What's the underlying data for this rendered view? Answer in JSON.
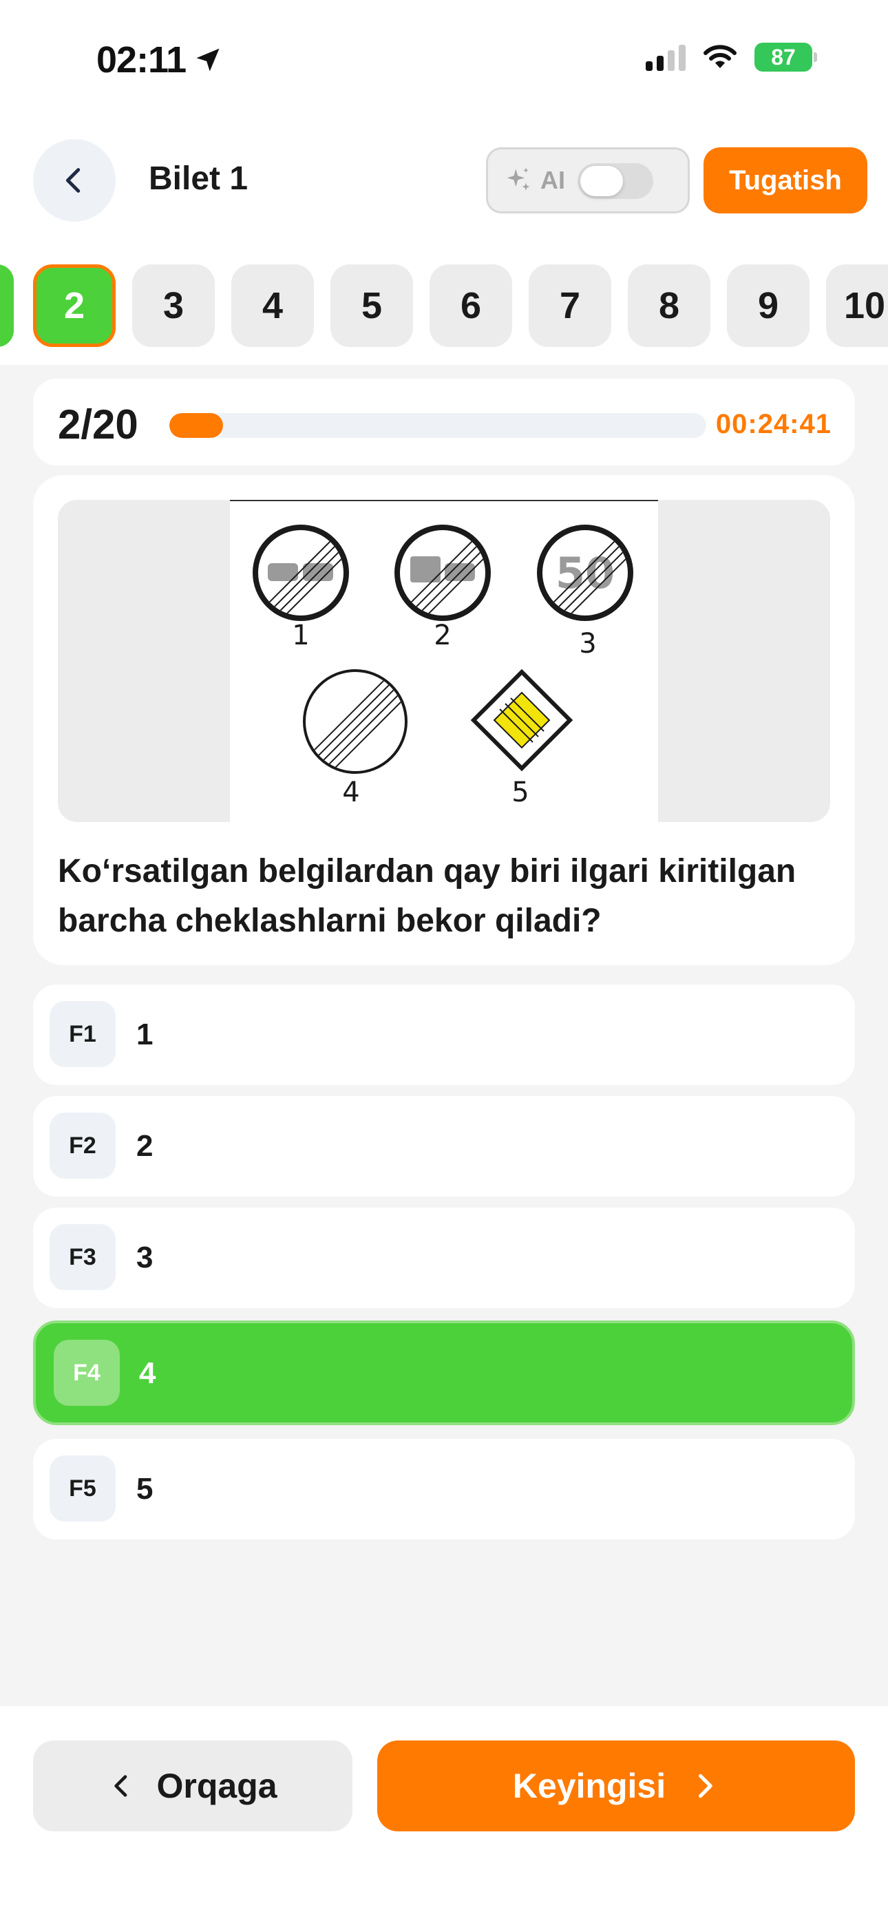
{
  "status_bar": {
    "time": "02:11",
    "battery": "87",
    "icons": [
      "location-arrow-icon",
      "cellular-signal-icon",
      "wifi-icon",
      "battery-charging-icon"
    ]
  },
  "header": {
    "back_icon": "chevron-left-icon",
    "title": "Bilet 1",
    "ai_label": "AI",
    "ai_icon": "sparkles-icon",
    "ai_enabled": false,
    "finish_label": "Tugatish"
  },
  "question_strip": {
    "numbers": [
      "2",
      "3",
      "4",
      "5",
      "6",
      "7",
      "8",
      "9",
      "10"
    ],
    "active": "2"
  },
  "progress": {
    "count": "2/20",
    "fraction": 0.1,
    "timer": "00:24:41"
  },
  "question": {
    "image_labels": [
      "1",
      "2",
      "3",
      "4",
      "5"
    ],
    "sign3_text": "50",
    "text": "Ko‘rsatilgan belgilardan qay biri ilgari kiritilgan barcha cheklashlarni bekor qiladi?"
  },
  "answers": [
    {
      "key": "F1",
      "text": "1",
      "selected": false
    },
    {
      "key": "F2",
      "text": "2",
      "selected": false
    },
    {
      "key": "F3",
      "text": "3",
      "selected": false
    },
    {
      "key": "F4",
      "text": "4",
      "selected": true
    },
    {
      "key": "F5",
      "text": "5",
      "selected": false
    }
  ],
  "nav": {
    "prev_label": "Orqaga",
    "next_label": "Keyingisi"
  },
  "colors": {
    "accent": "#ff7a00",
    "success": "#4cd13a"
  }
}
